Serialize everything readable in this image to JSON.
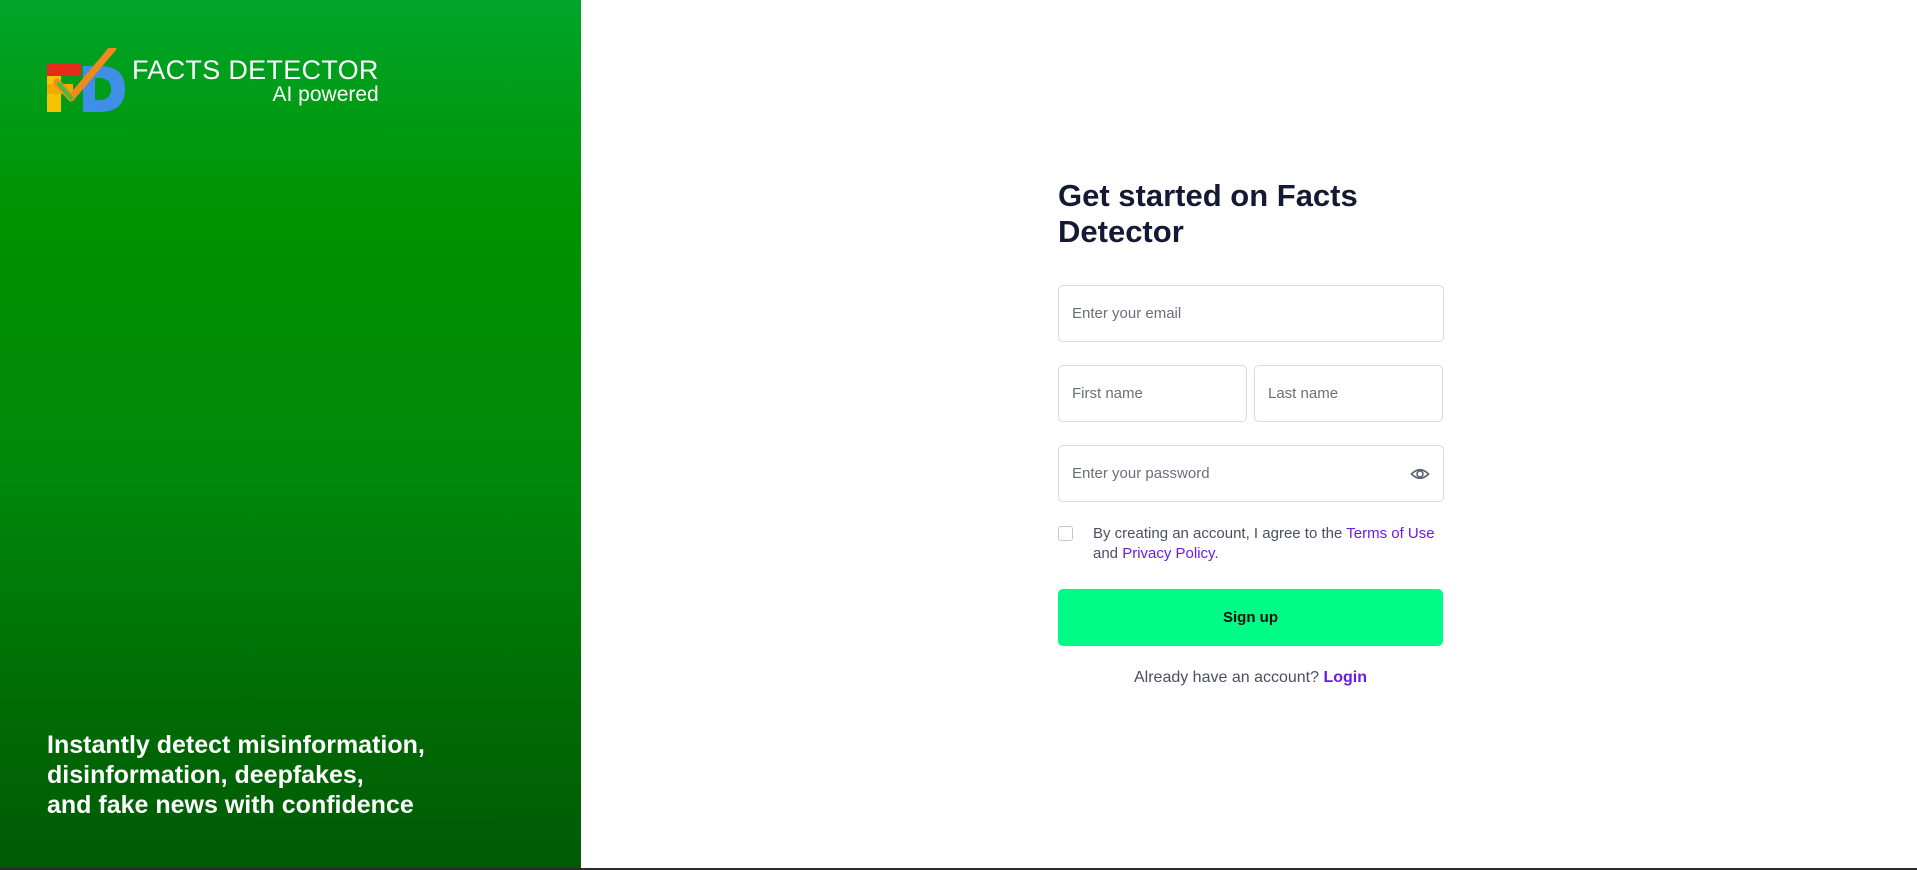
{
  "brand": {
    "title": "FACTS DETECTOR",
    "subtitle": "AI powered",
    "logo_icon": "fd-checkmark-logo",
    "primary_color": "#00a52a"
  },
  "tagline": {
    "line1": "Instantly detect misinformation,",
    "line2": "disinformation, deepfakes,",
    "line3": "and fake news with confidence"
  },
  "form": {
    "title": "Get started on Facts Detector",
    "email_placeholder": "Enter your email",
    "first_name_placeholder": "First name",
    "last_name_placeholder": "Last name",
    "password_placeholder": "Enter your password",
    "password_toggle_icon": "eye-icon",
    "terms_prefix": "By creating an account, I agree to the ",
    "terms_link": "Terms of Use",
    "terms_middle": " and ",
    "privacy_link": "Privacy Policy",
    "terms_suffix": ".",
    "terms_checked": false,
    "submit_label": "Sign up",
    "submit_color": "#00fb87",
    "login_prompt": "Already have an account? ",
    "login_link": "Login",
    "link_color": "#6a1be8"
  }
}
